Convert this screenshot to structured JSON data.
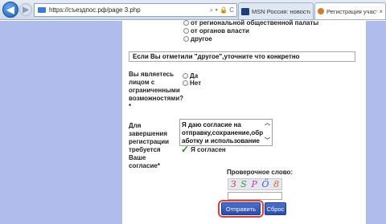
{
  "browser": {
    "address": "https://съездпос.рф/page 3.php",
    "address_tools": "⌕ ▾ 🔒 C",
    "tabs": [
      {
        "label": "MSN Россия: новости, погода..."
      },
      {
        "label": "Регистрация участников с..."
      }
    ],
    "tab_close": "×"
  },
  "form": {
    "options": [
      {
        "label": "от региональной общественной палаты"
      },
      {
        "label": "от органов власти"
      },
      {
        "label": "другое"
      }
    ],
    "other_value": "Если Вы отметили \"другое\",уточните что конкретно",
    "disability": {
      "question": "Вы являетесь лицом с ограниченными возможностями? *",
      "yes": "Да",
      "no": "Нет"
    },
    "consent": {
      "label": "Для завершения регистрации требуется Ваше согласие*",
      "text": "Я даю согласие на отправку,сохранение,обр аботку и использование",
      "agree": "Я согласен"
    },
    "captcha": {
      "label": "Проверочное слово:",
      "chars": [
        "З",
        "S",
        "P",
        "Ö",
        "8"
      ],
      "colors": [
        "#d13a3a",
        "#2f9a2f",
        "#c03c9a",
        "#3a5fd0",
        "#d06a2a"
      ]
    },
    "submit": "Отправить",
    "reset": "Сброс"
  }
}
